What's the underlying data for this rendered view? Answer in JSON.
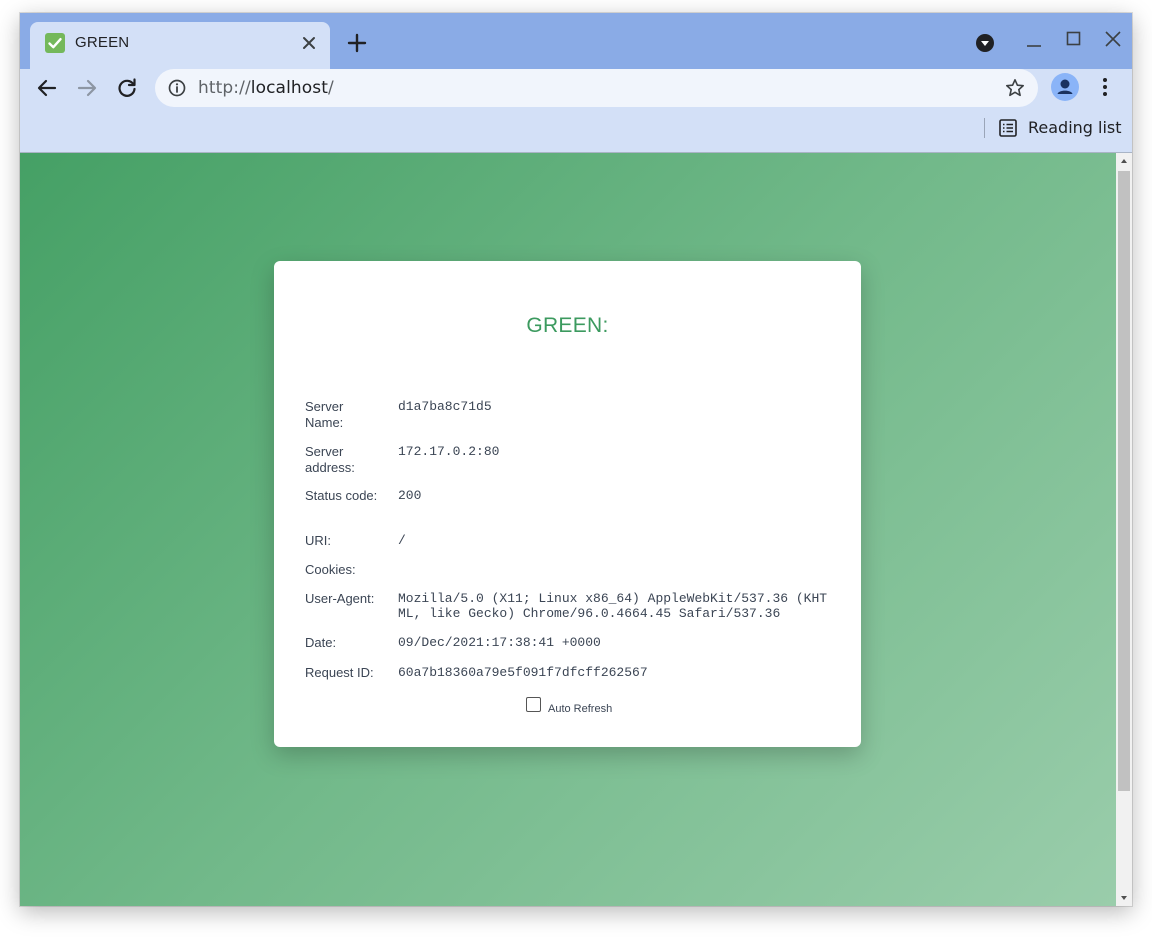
{
  "browser": {
    "tab": {
      "title": "GREEN",
      "favicon": "check-favicon-icon"
    },
    "address_bar": {
      "scheme": "http://",
      "host": "localhost",
      "path": "/"
    },
    "bookmarks_bar": {
      "reading_list_label": "Reading list"
    },
    "colors": {
      "tab_strip": "#8aabe6",
      "toolbar": "#d3e0f7",
      "favicon": "#74b85b"
    }
  },
  "page": {
    "title": "GREEN:",
    "rows": [
      {
        "label": "Server Name:",
        "value": "d1a7ba8c71d5"
      },
      {
        "label": "Server address:",
        "value": "172.17.0.2:80"
      },
      {
        "label": "Status code:",
        "value": "200"
      },
      {
        "label": "URI:",
        "value": "/"
      },
      {
        "label": "Cookies:",
        "value": ""
      },
      {
        "label": "User-Agent:",
        "value": "Mozilla/5.0 (X11; Linux x86_64) AppleWebKit/537.36 (KHTML, like Gecko) Chrome/96.0.4664.45 Safari/537.36"
      },
      {
        "label": "Date:",
        "value": "09/Dec/2021:17:38:41 +0000"
      },
      {
        "label": "Request ID:",
        "value": "60a7b18360a79e5f091f7dfcff262567"
      }
    ],
    "auto_refresh": {
      "label": "Auto Refresh",
      "checked": false
    },
    "colors": {
      "title": "#3c9a5f",
      "gradient_start": "#45a065",
      "gradient_end": "#9acdab"
    }
  }
}
